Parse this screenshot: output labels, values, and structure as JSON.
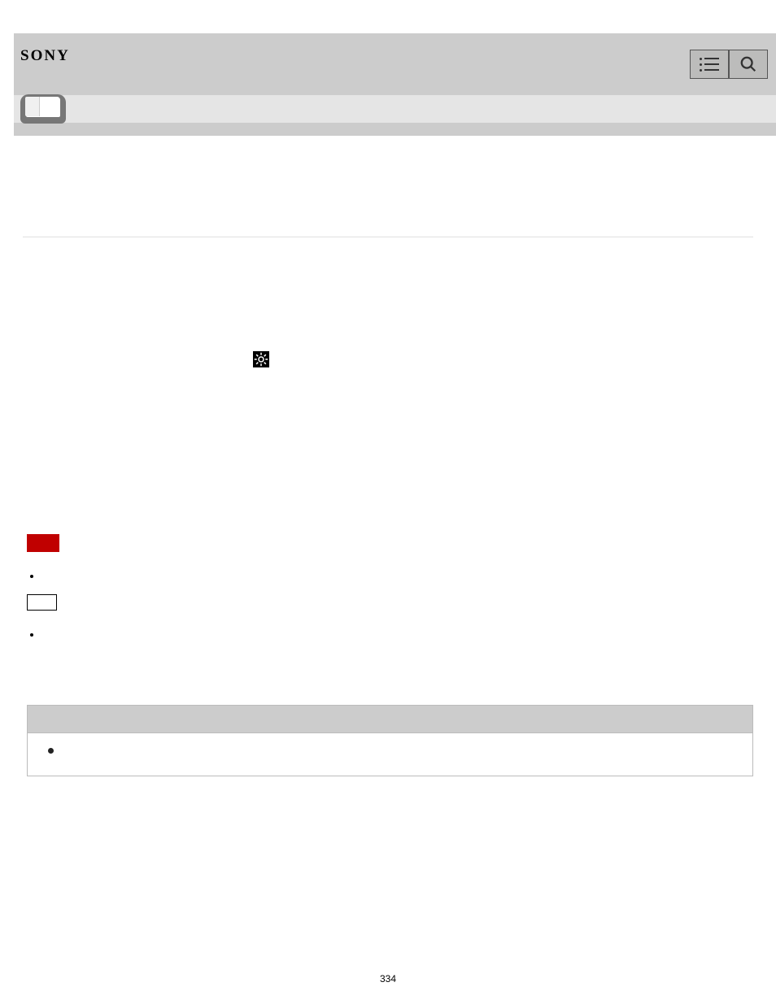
{
  "header": {
    "logo": "SONY"
  },
  "footer": {
    "page_number": "334"
  }
}
